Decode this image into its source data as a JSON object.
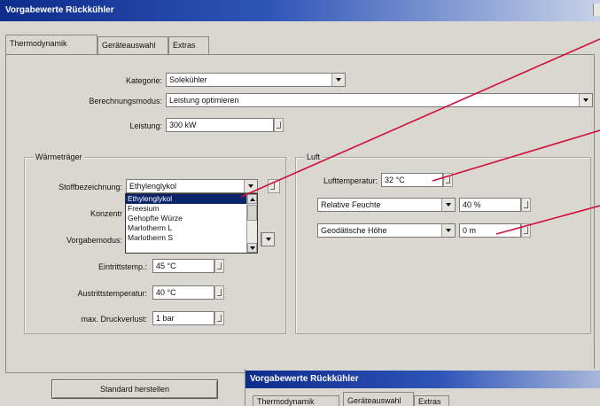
{
  "window": {
    "title": "Vorgabewerte Rückkühler"
  },
  "tabs": [
    "Thermodynamik",
    "Geräteauswahl",
    "Extras"
  ],
  "top": {
    "kategorie_label": "Kategorie:",
    "kategorie_value": "Solekühler",
    "berechnungsmodus_label": "Berechnungsmodus:",
    "berechnungsmodus_value": "Leistung optimieren",
    "leistung_label": "Leistung:",
    "leistung_value": "300 kW"
  },
  "waermetraeger": {
    "title": "Wärmeträger",
    "stoff_label": "Stoffbezeichnung:",
    "stoff_value": "Ethylenglykol",
    "konzentration_label": "Konzentr",
    "vorgabemodus_label": "Vorgabemodus:",
    "eintritt_label": "Eintrittstemp.:",
    "eintritt_value": "45 °C",
    "austritt_label": "Austrittstemperatur:",
    "austritt_value": "40 °C",
    "druck_label": "max. Druckverlust:",
    "druck_value": "1 bar",
    "dropdown_options": [
      "Ethylenglykol",
      "Freesium",
      "Gehopfte Würze",
      "Marlotherm L",
      "Marlotherm S"
    ]
  },
  "luft": {
    "title": "Luft",
    "temp_label": "Lufttemperatur:",
    "temp_value": "32 °C",
    "feuchte_mode": "Relative Feuchte",
    "feuchte_value": "40 %",
    "hoehe_mode": "Geodätische Höhe",
    "hoehe_value": "0 m"
  },
  "buttons": {
    "standard": "Standard herstellen"
  },
  "overlay": {
    "title": "Vorgabewerte Rückkühler",
    "tabs": [
      "Thermodynamik",
      "Geräteauswahl",
      "Extras"
    ]
  },
  "colors": {
    "annotation_line": "#d0103a",
    "selection": "#0a246a",
    "titlebar": "#0d2c8c"
  }
}
